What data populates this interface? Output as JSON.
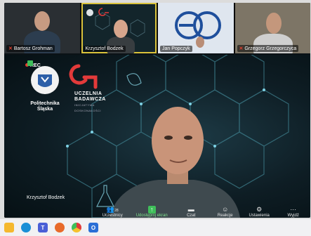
{
  "participants": [
    {
      "name": "Bartosz Grohman",
      "muted": true,
      "active": false
    },
    {
      "name": "Krzysztof Bodzek",
      "muted": false,
      "active": true
    },
    {
      "name": "Jan Popczyk",
      "muted": false,
      "active": false
    },
    {
      "name": "Grzegorz Grzegorczyca",
      "muted": true,
      "active": false
    }
  ],
  "stage": {
    "speaker_name": "Krzysztof Bodzek",
    "rec_label": "REC",
    "logo_left_text": "Politechnika Śląska",
    "logo_right_line1": "UCZELNIA",
    "logo_right_line2": "BADAWCZA",
    "logo_right_sub": "INICJATYWA DOSKONAŁOŚCI"
  },
  "toolbar": {
    "participants_count": "28",
    "participants_label": "Uczestnicy",
    "share_label": "Udostępnij ekran",
    "chat_label": "Czat",
    "reactions_label": "Reakcje",
    "settings_label": "Ustawienia",
    "leave_label": "Wyjdź"
  },
  "colors": {
    "active_border": "#d9c23b",
    "share_green": "#3fbf5a",
    "mute_red": "#e4412f"
  }
}
